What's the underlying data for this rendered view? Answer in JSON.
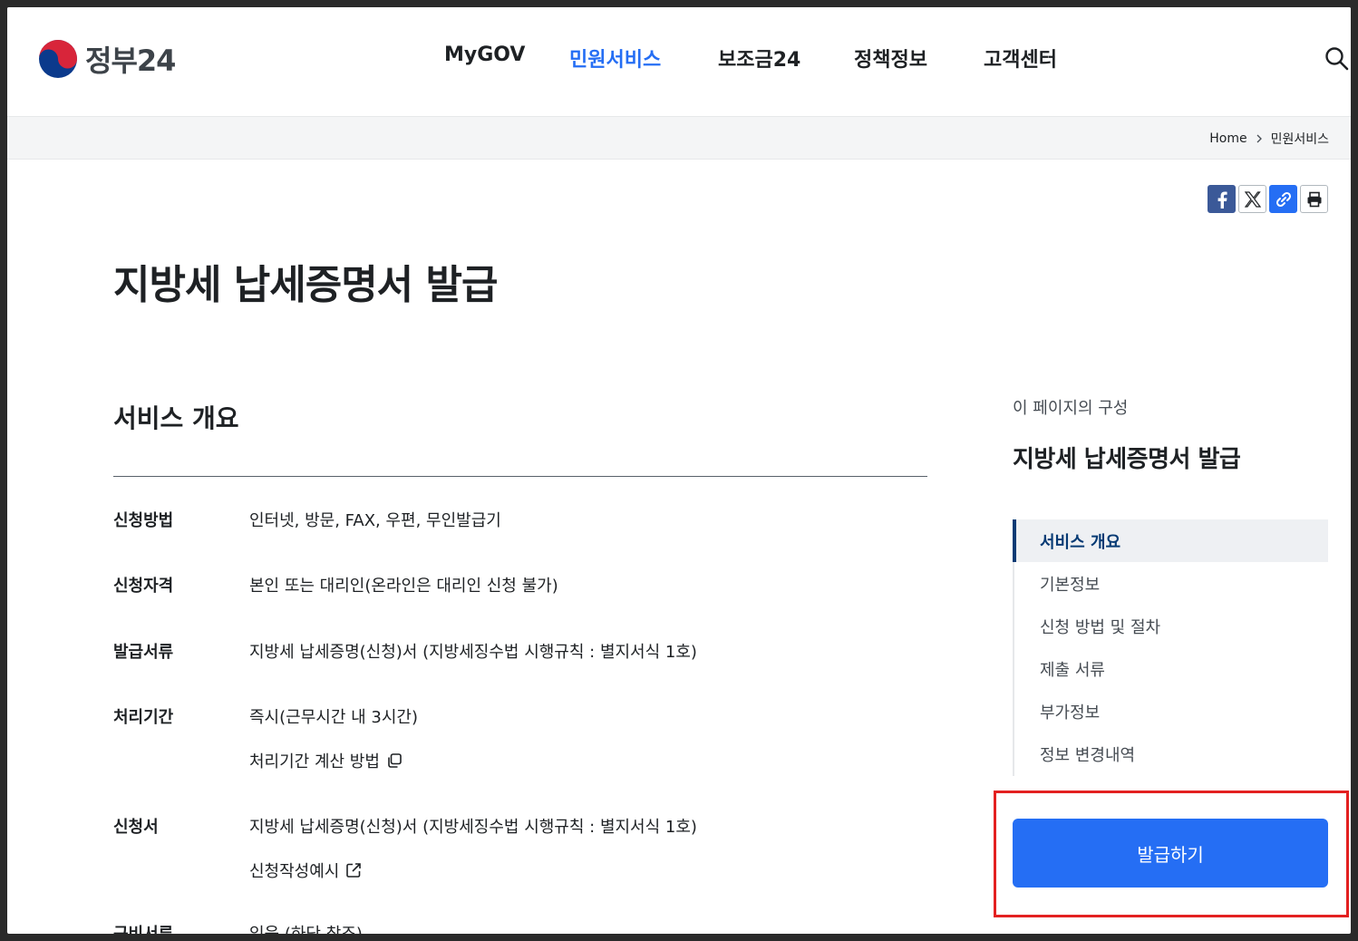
{
  "header": {
    "logo_text": "정부24",
    "nav": [
      {
        "label": "MyGOV",
        "active": false
      },
      {
        "label": "민원서비스",
        "active": true
      },
      {
        "label": "보조금24",
        "active": false
      },
      {
        "label": "정책정보",
        "active": false
      },
      {
        "label": "고객센터",
        "active": false
      }
    ],
    "search_icon": "search-icon"
  },
  "breadcrumb": {
    "home": "Home",
    "current": "민원서비스"
  },
  "share": [
    "facebook-icon",
    "x-icon",
    "link-icon",
    "print-icon"
  ],
  "page_title": "지방세 납세증명서 발급",
  "overview": {
    "title": "서비스 개요",
    "rows": [
      {
        "label": "신청방법",
        "values": [
          "인터넷, 방문, FAX, 우편, 무인발급기"
        ]
      },
      {
        "label": "신청자격",
        "values": [
          "본인 또는 대리인(온라인은 대리인 신청 불가)"
        ]
      },
      {
        "label": "발급서류",
        "values": [
          "지방세 납세증명(신청)서 (지방세징수법 시행규칙 : 별지서식 1호)"
        ]
      },
      {
        "label": "처리기간",
        "values": [
          "즉시(근무시간 내 3시간)"
        ],
        "link": "처리기간 계산 방법"
      },
      {
        "label": "신청서",
        "values": [
          "지방세 납세증명(신청)서 (지방세징수법 시행규칙 : 별지서식 1호)"
        ],
        "link": "신청작성예시"
      },
      {
        "label": "구비서류",
        "values": [
          "있음 (하단 참조)"
        ]
      }
    ]
  },
  "toc": {
    "caption": "이 페이지의 구성",
    "title": "지방세 납세증명서 발급",
    "items": [
      "서비스 개요",
      "기본정보",
      "신청 방법 및 절차",
      "제출 서류",
      "부가정보",
      "정보 변경내역"
    ]
  },
  "issue_button": "발급하기",
  "colors": {
    "primary": "#256ef4",
    "toc_active": "#063a74",
    "highlight": "#e32020"
  }
}
